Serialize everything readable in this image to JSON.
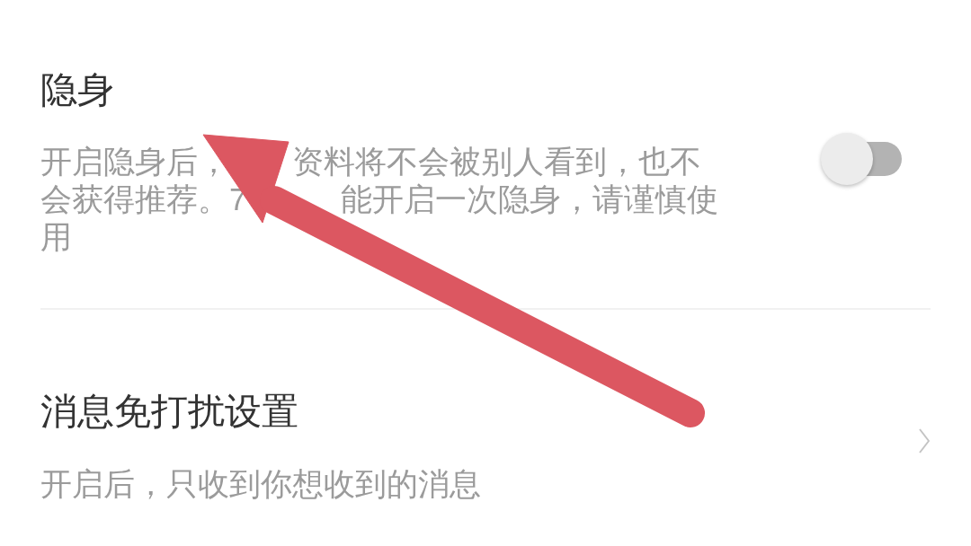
{
  "settings": [
    {
      "kind": "toggle",
      "title": "隐身",
      "description_lines": [
        [
          "开启隐身后，",
          "资料将不会被别人看到，也不"
        ],
        [
          "会获得推荐。7",
          "能开启一次隐身，请谨慎使"
        ],
        [
          "用"
        ]
      ],
      "on": false
    },
    {
      "kind": "link",
      "title": "消息免打扰设置",
      "description_lines": [
        [
          "开启后，只收到你想收到的消息"
        ]
      ]
    }
  ]
}
